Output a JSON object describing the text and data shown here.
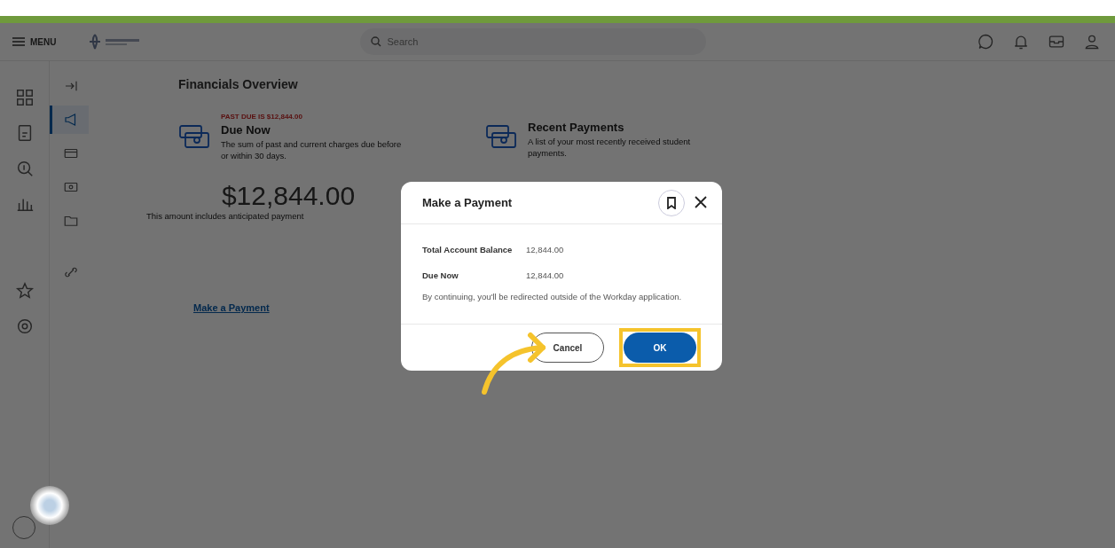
{
  "header": {
    "menu_label": "MENU",
    "search": {
      "placeholder": "Search"
    }
  },
  "rail": [
    {
      "selected": false
    },
    {
      "selected": false
    },
    {
      "selected": false
    },
    {
      "selected": false
    },
    {
      "selected": false
    },
    {
      "selected": false
    }
  ],
  "subnav": [
    {
      "selected": false
    },
    {
      "selected": true
    },
    {
      "selected": false
    },
    {
      "selected": false
    },
    {
      "selected": false
    },
    {
      "selected": false
    }
  ],
  "page_title": "Financials Overview",
  "cards": [
    {
      "alert": "PAST DUE IS $12,844.00",
      "title": "Due Now",
      "description": "The sum of past and current charges due before or within 30 days.",
      "amount": "$12,844.00",
      "note": "This amount includes anticipated payment"
    },
    {
      "title": "Recent Payments",
      "description": "A list of your most recently received student payments."
    }
  ],
  "link": "Make a Payment",
  "dialog": {
    "title": "Make a Payment",
    "rows": [
      {
        "label": "Total Account Balance",
        "value": "12,844.00"
      },
      {
        "label": "Due Now",
        "value": "12,844.00"
      }
    ],
    "message": "By continuing, you'll be redirected outside of the Workday application.",
    "buttons": [
      {
        "label": "Cancel",
        "kind": "secondary",
        "highlighted": false
      },
      {
        "label": "OK",
        "kind": "primary",
        "highlighted": true
      }
    ]
  }
}
